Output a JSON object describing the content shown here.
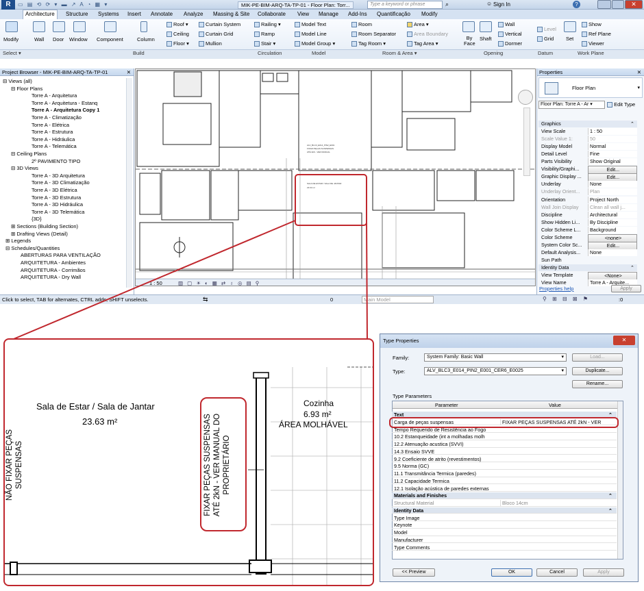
{
  "titlebar": {
    "title": "MIK-PE-BIM-ARQ-TA-TP-01 - Floor Plan: Torr...",
    "search_placeholder": "Type a keyword or phrase",
    "sign_in": "Sign In"
  },
  "tabs": [
    "Architecture",
    "Structure",
    "Systems",
    "Insert",
    "Annotate",
    "Analyze",
    "Massing & Site",
    "Collaborate",
    "View",
    "Manage",
    "Add-Ins",
    "Quantificação",
    "Modify"
  ],
  "ribbon": {
    "modify": "Modify",
    "wall": "Wall",
    "door": "Door",
    "window": "Window",
    "component": "Component",
    "column": "Column",
    "roof": "Roof",
    "ceiling": "Ceiling",
    "floor": "Floor",
    "curtain_system": "Curtain System",
    "curtain_grid": "Curtain Grid",
    "mullion": "Mullion",
    "railing": "Railing",
    "ramp": "Ramp",
    "stair": "Stair",
    "model_text": "Model Text",
    "model_line": "Model Line",
    "model_group": "Model Group",
    "room": "Room",
    "room_separator": "Room Separator",
    "tag_room": "Tag Room",
    "area": "Area",
    "area_boundary": "Area Boundary",
    "tag_area": "Tag Area",
    "by_face": "By Face",
    "shaft": "Shaft",
    "wall_open": "Wall",
    "vertical": "Vertical",
    "dormer": "Dormer",
    "level": "Level",
    "grid": "Grid",
    "set": "Set",
    "show": "Show",
    "ref_plane": "Ref Plane",
    "viewer": "Viewer",
    "groups": [
      "Select",
      "Build",
      "Circulation",
      "Model",
      "Room & Area",
      "Opening",
      "Datum",
      "Work Plane"
    ]
  },
  "project_browser": {
    "title": "Project Browser - MIK-PE-BIM-ARQ-TA-TP-01",
    "items": [
      "Views (all)",
      "Floor Plans",
      "Torre A - Arquitetura",
      "Torre A - Arquitetura - Estanq",
      "Torre A - Arquitetura Copy 1",
      "Torre A - Climatização",
      "Torre A - Elétrica",
      "Torre A - Estrutura",
      "Torre A - Hidráulica",
      "Torre A - Telemática",
      "Ceiling Plans",
      "2º PAVIMENTO TIPO",
      "3D Views",
      "Torre A - 3D Arquitetura",
      "Torre A - 3D Climatização",
      "Torre A - 3D Elétrica",
      "Torre A - 3D Estrutura",
      "Torre A - 3D Hidráulica",
      "Torre A - 3D Telemática",
      "{3D}",
      "Sections (Building Section)",
      "Drafting Views (Detail)",
      "Legends",
      "Schedules/Quantities",
      "ABERTURAS PARA VENTILAÇÃO",
      "ARQUITETURA - Ambientes",
      "ARQUITETURA - Corrimãos",
      "ARQUITETURA - Dry Wall"
    ]
  },
  "canvas": {
    "scale": "1 : 50"
  },
  "properties": {
    "title": "Properties",
    "type_name": "Floor Plan",
    "selector": "Floor Plan: Torre A - Ar",
    "edit_type": "Edit Type",
    "rows": [
      {
        "k": "Graphics",
        "v": "",
        "sec": true
      },
      {
        "k": "View Scale",
        "v": "1 : 50"
      },
      {
        "k": "Scale Value 1:",
        "v": "50"
      },
      {
        "k": "Display Model",
        "v": "Normal"
      },
      {
        "k": "Detail Level",
        "v": "Fine"
      },
      {
        "k": "Parts Visibility",
        "v": "Show Original"
      },
      {
        "k": "Visibility/Graphi...",
        "v": "Edit..."
      },
      {
        "k": "Graphic Display ...",
        "v": "Edit..."
      },
      {
        "k": "Underlay",
        "v": "None"
      },
      {
        "k": "Underlay Orient...",
        "v": "Plan"
      },
      {
        "k": "Orientation",
        "v": "Project North"
      },
      {
        "k": "Wall Join Display",
        "v": "Clean all wall j..."
      },
      {
        "k": "Discipline",
        "v": "Architectural"
      },
      {
        "k": "Show Hidden Li...",
        "v": "By Discipline"
      },
      {
        "k": "Color Scheme L...",
        "v": "Background"
      },
      {
        "k": "Color Scheme",
        "v": "<none>"
      },
      {
        "k": "System Color Sc...",
        "v": "Edit..."
      },
      {
        "k": "Default Analysis...",
        "v": "None"
      },
      {
        "k": "Sun Path",
        "v": ""
      },
      {
        "k": "Identity Data",
        "v": "",
        "sec": true
      },
      {
        "k": "View Template",
        "v": "<None>"
      },
      {
        "k": "View Name",
        "v": "Torre A - Arquite..."
      }
    ],
    "help": "Properties help",
    "apply": "Apply"
  },
  "status": {
    "text": "Click to select, TAB for alternates, CTRL adds, SHIFT unselects.",
    "model": "Main Model",
    "zero": "0"
  },
  "zoom": {
    "room1_name": "Sala de Estar / Sala de Jantar",
    "room1_area": "23.63 m²",
    "room2_name": "Cozinha",
    "room2_area": "6.93 m²",
    "room2_note": "ÁREA MOLHÁVEL",
    "wall_note_lines": [
      "FIXAR PEÇAS SUSPENSAS",
      "ATÉ 2kN - VER MANUAL DO",
      "PROPRIETÁRIO"
    ],
    "left_note_lines": [
      "NÃO FIXAR PEÇAS",
      "SUSPENSAS"
    ]
  },
  "type_properties": {
    "title": "Type Properties",
    "family_label": "Family:",
    "family_value": "System Family: Basic Wall",
    "load": "Load...",
    "type_label": "Type:",
    "type_value": "ALV_BLC3_E014_PIN2_E001_CER6_E0025",
    "duplicate": "Duplicate...",
    "rename": "Rename...",
    "section_title": "Type Parameters",
    "col_param": "Parameter",
    "col_value": "Value",
    "rows": [
      {
        "p": "Text",
        "v": "",
        "sec": true
      },
      {
        "p": "Carga de peças suspensas",
        "v": "FIXAR PEÇAS SUSPENSAS ATÉ 2kN - VER"
      },
      {
        "p": "Tempo Requerido de Resistência ao Fogo",
        "v": ""
      },
      {
        "p": "10.2 Estanqueidade (int a molhadas molh",
        "v": ""
      },
      {
        "p": "12.2 Atenuação acustica (SVVI)",
        "v": ""
      },
      {
        "p": "14.3 Ensaio SVVE",
        "v": ""
      },
      {
        "p": "9.2 Coeficiente de atrito (revestimentos)",
        "v": ""
      },
      {
        "p": "9.5 Norma (GC)",
        "v": ""
      },
      {
        "p": "11.1 Transmitância Termica (paredes)",
        "v": ""
      },
      {
        "p": "11.2 Capacidade Termica",
        "v": ""
      },
      {
        "p": "12.1 Isolação acústica de paredes externas",
        "v": ""
      },
      {
        "p": "Materials and Finishes",
        "v": "",
        "sec": true
      },
      {
        "p": "Structural Material",
        "v": "Bloco 14cm"
      },
      {
        "p": "Identity Data",
        "v": "",
        "sec": true
      },
      {
        "p": "Type Image",
        "v": ""
      },
      {
        "p": "Keynote",
        "v": ""
      },
      {
        "p": "Model",
        "v": ""
      },
      {
        "p": "Manufacturer",
        "v": ""
      },
      {
        "p": "Type Comments",
        "v": ""
      }
    ],
    "preview": "<< Preview",
    "ok": "OK",
    "cancel": "Cancel",
    "apply": "Apply"
  }
}
